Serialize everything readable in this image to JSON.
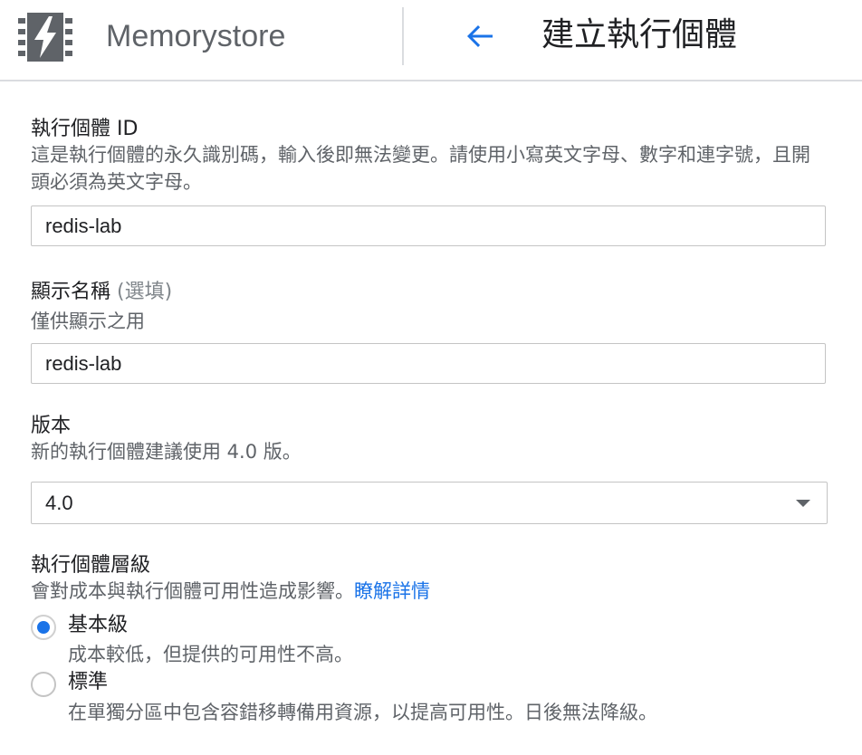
{
  "header": {
    "product_name": "Memorystore",
    "page_title": "建立執行個體",
    "back_icon": "arrow-back-icon",
    "logo_icon": "memorystore-lightning-chip-icon",
    "accent_color": "#1a73e8"
  },
  "instance_id": {
    "label": "執行個體 ID",
    "help": "這是執行個體的永久識別碼，輸入後即無法變更。請使用小寫英文字母、數字和連字號，且開頭必須為英文字母。",
    "value": "redis-lab"
  },
  "display_name": {
    "label": "顯示名稱",
    "optional": "(選填)",
    "help": "僅供顯示之用",
    "value": "redis-lab"
  },
  "version": {
    "label": "版本",
    "help": "新的執行個體建議使用 4.0 版。",
    "selected": "4.0"
  },
  "tier": {
    "label": "執行個體層級",
    "help": "會對成本與執行個體可用性造成影響。",
    "learn_more": "瞭解詳情",
    "options": [
      {
        "label": "基本級",
        "description": "成本較低，但提供的可用性不高。",
        "checked": true
      },
      {
        "label": "標準",
        "description": "在單獨分區中包含容錯移轉備用資源，以提高可用性。日後無法降級。",
        "checked": false
      }
    ]
  }
}
